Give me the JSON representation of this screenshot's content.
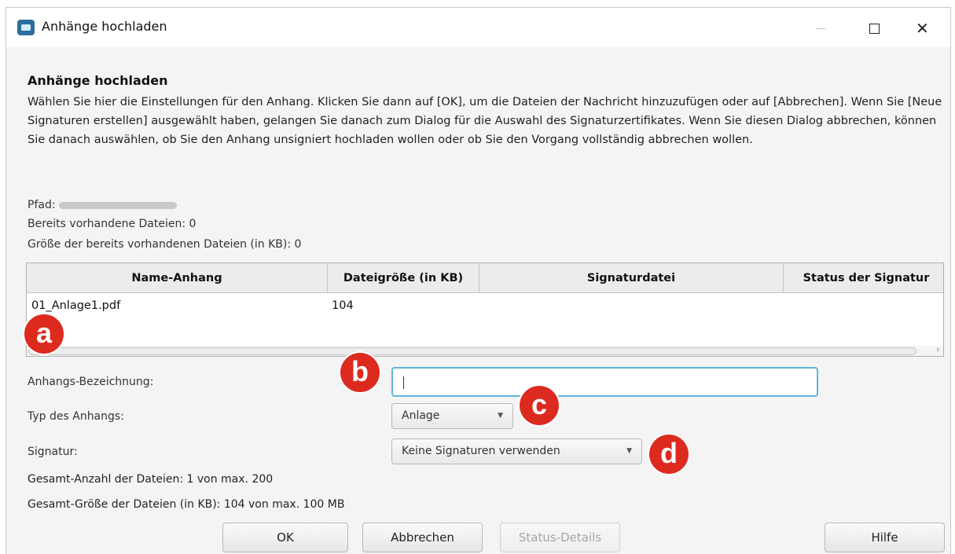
{
  "window": {
    "title": "Anhänge hochladen"
  },
  "dialog": {
    "heading": "Anhänge hochladen",
    "description": "Wählen Sie hier die Einstellungen für den Anhang. Klicken Sie dann auf [OK], um die Dateien der Nachricht hinzuzufügen oder auf [Abbrechen]. Wenn Sie [Neue Signaturen erstellen] ausgewählt haben, gelangen Sie danach zum Dialog für die Auswahl des Signaturzertifikates. Wenn Sie diesen Dialog abbrechen, können Sie danach auswählen, ob Sie den Anhang unsigniert hochladen wollen oder ob Sie den Vorgang vollständig abbrechen wollen.",
    "path_label": "Pfad:",
    "existing_files": "Bereits vorhandene Dateien: 0",
    "existing_size": "Größe der bereits vorhandenen Dateien (in KB): 0"
  },
  "table": {
    "columns": [
      "Name-Anhang",
      "Dateigröße (in KB)",
      "Signaturdatei",
      "Status der Signatur"
    ],
    "rows": [
      {
        "name": "01_Anlage1.pdf",
        "size": "104",
        "signature_file": "",
        "status": ""
      }
    ]
  },
  "form": {
    "label_label": "Anhangs-Bezeichnung:",
    "label_value": "",
    "type_label": "Typ des Anhangs:",
    "type_value": "Anlage",
    "signature_label": "Signatur:",
    "signature_value": "Keine Signaturen verwenden"
  },
  "summary": {
    "count": "Gesamt-Anzahl der Dateien: 1 von max. 200",
    "size": "Gesamt-Größe der Dateien (in KB): 104 von max. 100 MB"
  },
  "buttons": {
    "ok": "OK",
    "cancel": "Abbrechen",
    "status_details": "Status-Details",
    "help": "Hilfe"
  },
  "markers": [
    "a",
    "b",
    "c",
    "d"
  ],
  "colors": {
    "marker": "#dd2a1f",
    "input_focus": "#5fb6d9",
    "app_icon": "#2b6f9e"
  },
  "icons": {
    "app": "app-icon",
    "minimize": "minimize-icon",
    "maximize": "maximize-icon",
    "close": "close-icon",
    "dropdown": "chevron-down-icon",
    "scroll_right": "chevron-right-icon"
  }
}
